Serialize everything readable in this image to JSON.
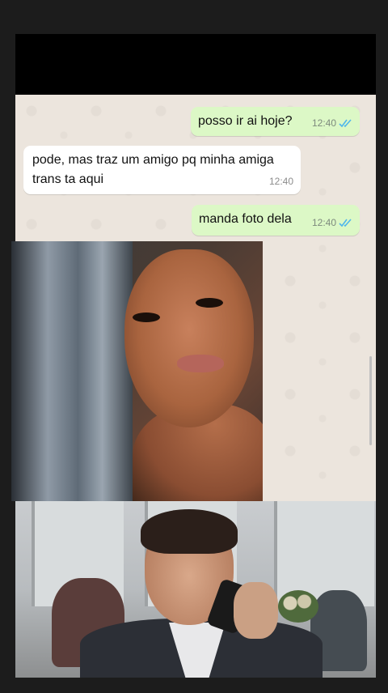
{
  "chat": {
    "messages": [
      {
        "direction": "outgoing",
        "text": "posso ir ai hoje?",
        "time": "12:40",
        "status": "read"
      },
      {
        "direction": "incoming",
        "text": "pode, mas traz um amigo pq minha amiga trans ta aqui",
        "time": "12:40"
      },
      {
        "direction": "outgoing",
        "text": "manda foto dela",
        "time": "12:40",
        "status": "read"
      }
    ]
  },
  "colors": {
    "outgoing_bubble": "#dcf8c6",
    "incoming_bubble": "#ffffff",
    "read_ticks": "#4fb6ec",
    "chat_background": "#ece5dd"
  },
  "icons": {
    "read_receipt": "double-check-icon"
  }
}
